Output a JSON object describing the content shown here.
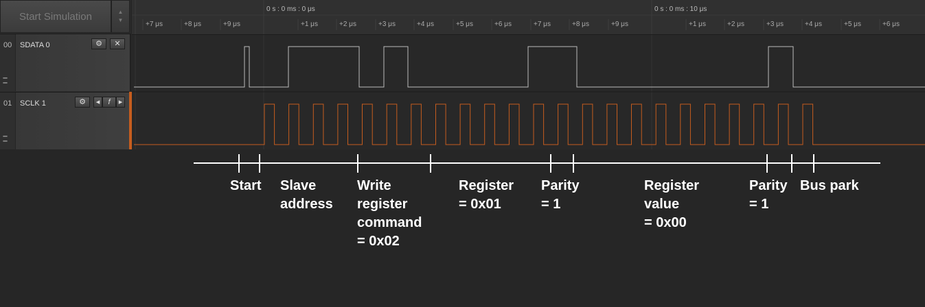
{
  "toolbar": {
    "start_simulation": "Start Simulation"
  },
  "channels": [
    {
      "num": "00",
      "name": "SDATA 0",
      "buttons": [
        "⚙",
        "✕"
      ],
      "color": "#bdbdbd"
    },
    {
      "num": "01",
      "name": "SCLK 1",
      "buttons": [
        "⚙",
        "◂",
        "f",
        "▸"
      ],
      "color": "#c65d1e"
    }
  ],
  "ruler": {
    "markers": [
      {
        "label": "0 s : 0 ms : 0 μs"
      },
      {
        "label": "0 s : 0 ms : 10 μs"
      }
    ],
    "ticks": [
      "+7 μs",
      "+8 μs",
      "+9 μs",
      "+1 μs",
      "+2 μs",
      "+3 μs",
      "+4 μs",
      "+5 μs",
      "+6 μs",
      "+7 μs",
      "+8 μs",
      "+9 μs",
      "+1 μs",
      "+2 μs",
      "+3 μs",
      "+4 μs",
      "+5 μs",
      "+6 μs"
    ]
  },
  "annotations": [
    {
      "text": "Start"
    },
    {
      "text": "Slave\naddress"
    },
    {
      "text": "Write\nregister\ncommand\n= 0x02"
    },
    {
      "text": "Register\n= 0x01"
    },
    {
      "text": "Parity\n= 1"
    },
    {
      "text": "Register\nvalue\n= 0x00"
    },
    {
      "text": "Parity\n= 1"
    },
    {
      "text": "Bus park"
    }
  ]
}
